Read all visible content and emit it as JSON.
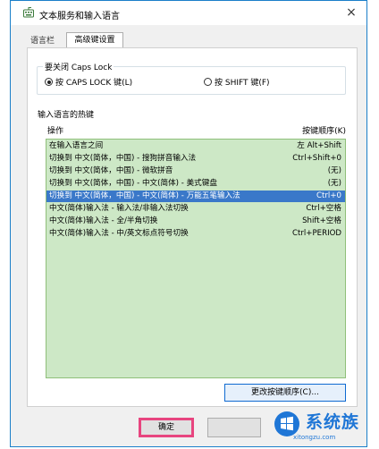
{
  "window": {
    "title": "文本服务和输入语言",
    "close_glyph": "×"
  },
  "tabs": [
    {
      "label": "语言栏",
      "active": false
    },
    {
      "label": "高级键设置",
      "active": true
    }
  ],
  "caps_lock": {
    "caption": "要关闭 Caps Lock",
    "options": [
      {
        "label": "按 CAPS LOCK 键(L)",
        "selected": true
      },
      {
        "label": "按 SHIFT 键(F)",
        "selected": false
      }
    ]
  },
  "hotkeys": {
    "caption": "输入语言的热键",
    "col_action": "操作",
    "col_keys": "按键顺序(K)",
    "rows": [
      {
        "action": "在输入语言之间",
        "keys": "左 Alt+Shift",
        "selected": false
      },
      {
        "action": "切换到 中文(简体，中国) - 搜狗拼音输入法",
        "keys": "Ctrl+Shift+0",
        "selected": false
      },
      {
        "action": "切换到 中文(简体，中国) - 微软拼音",
        "keys": "(无)",
        "selected": false
      },
      {
        "action": "切换到 中文(简体，中国) - 中文(简体) - 美式键盘",
        "keys": "(无)",
        "selected": false
      },
      {
        "action": "切换到 中文(简体，中国) - 中文(简体) - 万能五笔输入法",
        "keys": "Ctrl+0",
        "selected": true
      },
      {
        "action": "中文(简体)输入法 - 输入法/非输入法切换",
        "keys": "Ctrl+空格",
        "selected": false
      },
      {
        "action": "中文(简体)输入法 - 全/半角切换",
        "keys": "Shift+空格",
        "selected": false
      },
      {
        "action": "中文(简体)输入法 - 中/英文标点符号切换",
        "keys": "Ctrl+PERIOD",
        "selected": false
      }
    ],
    "change_button": "更改按键顺序(C)..."
  },
  "footer": {
    "ok_label": "确定"
  },
  "watermark": {
    "brand": "系统族",
    "url": "xitongzu.com"
  },
  "colors": {
    "list_bg": "#cde8c6",
    "selection": "#3a78c9",
    "ok_highlight": "#e8457f",
    "brand": "#1f76d6"
  }
}
